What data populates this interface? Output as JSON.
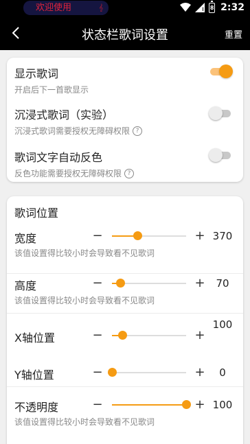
{
  "status_bar": {
    "lyric": "欢迎使用",
    "lyric_extra": "𝄞",
    "time": "2:32",
    "battery": "8"
  },
  "app_bar": {
    "title": "状态栏歌词设置",
    "reset": "重置"
  },
  "toggles": [
    {
      "title": "显示歌词",
      "desc": "开启后下一首歌显示",
      "on": true,
      "help": false
    },
    {
      "title": "沉浸式歌词（实验）",
      "desc": "沉浸式歌词需要授权无障碍权限",
      "on": false,
      "help": true
    },
    {
      "title": "歌词文字自动反色",
      "desc": "反色功能需要授权无障碍权限",
      "on": false,
      "help": true
    }
  ],
  "position": {
    "title": "歌词位置",
    "minus": "−",
    "plus": "+",
    "help": "?",
    "sliders": [
      {
        "label": "宽度",
        "value": "370",
        "level": 0.34,
        "desc": "该值设置得比较小时会导致看不见歌词"
      },
      {
        "label": "高度",
        "value": "70",
        "level": 0.11,
        "desc": "该值设置得比较小时会导致看不见歌词"
      },
      {
        "label": "X轴位置",
        "value": "100",
        "level": 0.14,
        "desc": ""
      },
      {
        "label": "Y轴位置",
        "value": "0",
        "level": 0.0,
        "desc": ""
      },
      {
        "label": "不透明度",
        "value": "100",
        "level": 1.0,
        "desc": "该值设置得比较小时会导致看不见歌词"
      }
    ]
  },
  "colors": {
    "accent": "#f59b13",
    "accent_light": "#fbc27a",
    "off_track": "#c8c8c8"
  }
}
